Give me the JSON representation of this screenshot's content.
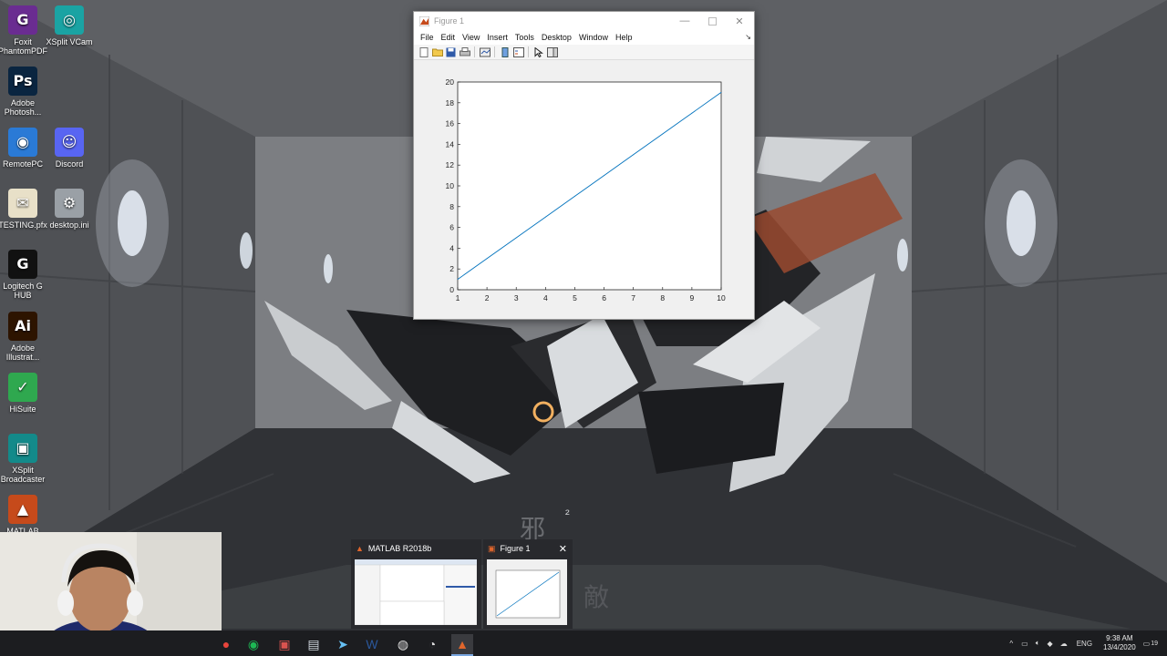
{
  "desktop": {
    "icons": [
      {
        "label": "Foxit PhantomPDF",
        "icon": "foxit-pdf-icon",
        "color": "#6a2c91",
        "glyph": "G"
      },
      {
        "label": "XSplit VCam",
        "icon": "xsplit-vcam-icon",
        "color": "#1aa3a3",
        "glyph": "◎"
      },
      {
        "label": "Adobe Photosh...",
        "icon": "photoshop-icon",
        "color": "#0a2540",
        "glyph": "Ps"
      },
      {
        "label": "RemotePC",
        "icon": "remotepc-icon",
        "color": "#2a7ad6",
        "glyph": "◉"
      },
      {
        "label": "Discord",
        "icon": "discord-icon",
        "color": "#5865f2",
        "glyph": "☺"
      },
      {
        "label": "TESTING.pfx",
        "icon": "certificate-icon",
        "color": "#e8e0c8",
        "glyph": "✉"
      },
      {
        "label": "desktop.ini",
        "icon": "settings-file-icon",
        "color": "#9aa0a6",
        "glyph": "⚙"
      },
      {
        "label": "Logitech G HUB",
        "icon": "logitech-ghub-icon",
        "color": "#111111",
        "glyph": "G"
      },
      {
        "label": "Adobe Illustrat...",
        "icon": "illustrator-icon",
        "color": "#2d1400",
        "glyph": "Ai"
      },
      {
        "label": "HiSuite",
        "icon": "hisuite-icon",
        "color": "#2fa84f",
        "glyph": "✓"
      },
      {
        "label": "XSplit Broadcaster",
        "icon": "xsplit-broadcaster-icon",
        "color": "#138a8a",
        "glyph": "▣"
      },
      {
        "label": "MATLAB",
        "icon": "matlab-icon",
        "color": "#c64a1b",
        "glyph": "▲"
      }
    ]
  },
  "figure_window": {
    "title": "Figure 1",
    "menu": [
      "File",
      "Edit",
      "View",
      "Insert",
      "Tools",
      "Desktop",
      "Window",
      "Help"
    ],
    "dock_arrow": "↘",
    "toolbar": [
      "new-figure-icon",
      "open-file-icon",
      "save-icon",
      "print-icon",
      "link-plot-icon",
      "insert-colorbar-icon",
      "insert-legend-icon",
      "edit-plot-icon",
      "plot-tools-icon"
    ]
  },
  "chart_data": {
    "type": "line",
    "x": [
      1,
      2,
      3,
      4,
      5,
      6,
      7,
      8,
      9,
      10
    ],
    "series": [
      {
        "values": [
          1,
          3,
          5,
          7,
          9,
          11,
          13,
          15,
          17,
          19
        ],
        "color": "#0072bd"
      }
    ],
    "xlim": [
      1,
      10
    ],
    "ylim": [
      0,
      20
    ],
    "xticks": [
      1,
      2,
      3,
      4,
      5,
      6,
      7,
      8,
      9,
      10
    ],
    "yticks": [
      0,
      2,
      4,
      6,
      8,
      10,
      12,
      14,
      16,
      18,
      20
    ],
    "title": "",
    "xlabel": "",
    "ylabel": "",
    "grid": false
  },
  "taskbar_previews": [
    {
      "title": "MATLAB R2018b"
    },
    {
      "title": "Figure 1"
    }
  ],
  "taskbar": {
    "pinned": [
      "chrome-icon",
      "spotify-icon",
      "teams-icon",
      "file-explorer-icon",
      "steam-icon",
      "word-icon",
      "obs-icon",
      "clock-app-icon",
      "matlab-icon"
    ],
    "tray": {
      "language": "ENG",
      "time": "9:38 AM",
      "date": "13/4/2020",
      "notifications": "19"
    }
  },
  "wallpaper_text": {
    "mark": "²"
  }
}
